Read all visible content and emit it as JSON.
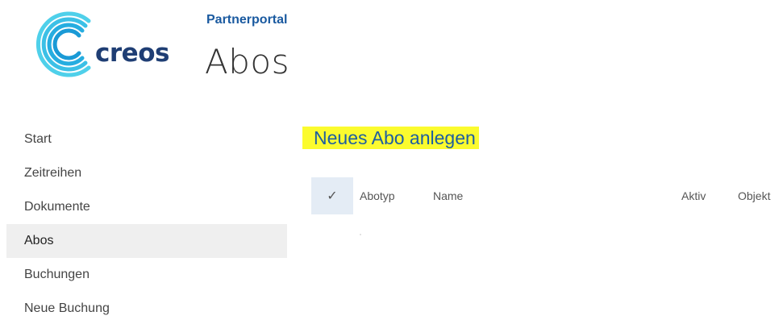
{
  "branding": {
    "logo_text": "creos",
    "logo_colors": {
      "outer": "#3cc7e8",
      "inner": "#1aa6dc",
      "text": "#1f3e74"
    }
  },
  "header": {
    "site_title": "Partnerportal",
    "page_title": "Abos"
  },
  "sidebar": {
    "items": [
      {
        "label": "Start",
        "selected": false
      },
      {
        "label": "Zeitreihen",
        "selected": false
      },
      {
        "label": "Dokumente",
        "selected": false
      },
      {
        "label": "Abos",
        "selected": true
      },
      {
        "label": "Buchungen",
        "selected": false
      },
      {
        "label": "Neue Buchung",
        "selected": false
      }
    ]
  },
  "main": {
    "new_item_link": "Neues Abo anlegen",
    "highlight_color": "#fbfb2e",
    "list": {
      "select_all_glyph": "✓",
      "columns": [
        "Abotyp",
        "Name",
        "Aktiv",
        "Objekt"
      ],
      "rows": []
    }
  }
}
